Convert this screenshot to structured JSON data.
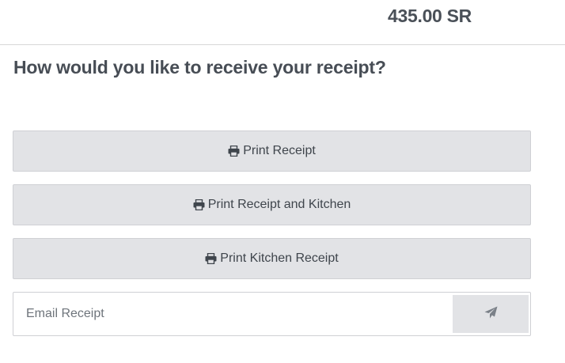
{
  "order": {
    "total": "435.00 SR"
  },
  "receipt": {
    "question": "How would you like to receive your receipt?",
    "buttons": [
      {
        "label": "Print Receipt",
        "icon": "print-icon"
      },
      {
        "label": "Print Receipt and Kitchen",
        "icon": "print-icon"
      },
      {
        "label": "Print Kitchen Receipt",
        "icon": "print-icon"
      }
    ],
    "email": {
      "placeholder": "Email Receipt",
      "value": "",
      "send_icon": "paper-plane-icon"
    }
  },
  "colors": {
    "button_bg": "#e2e3e6",
    "button_border": "#cfd0d4",
    "text": "#3f454c",
    "send_icon": "#7a8088"
  }
}
